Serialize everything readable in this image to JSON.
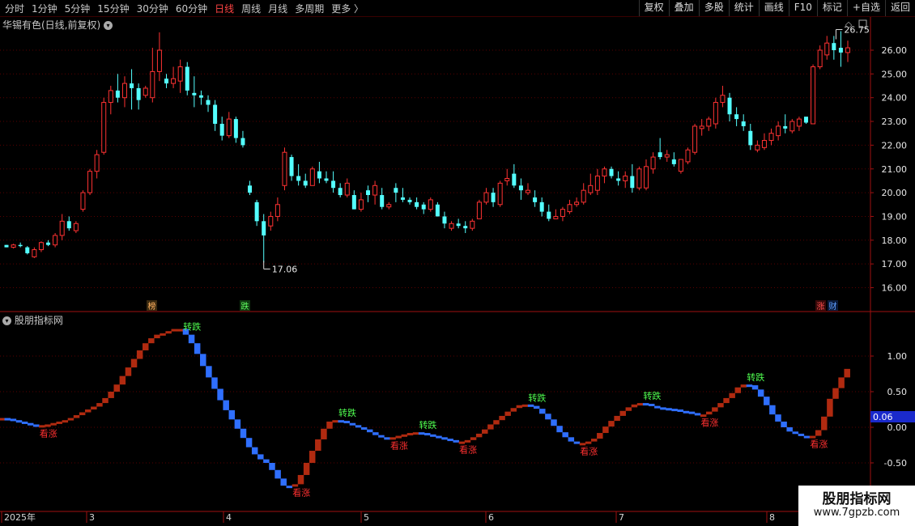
{
  "toolbar": {
    "periods": [
      "分时",
      "1分钟",
      "5分钟",
      "15分钟",
      "30分钟",
      "60分钟",
      "日线",
      "周线",
      "月线",
      "多周期",
      "更多 〉"
    ],
    "active_period": "日线",
    "actions": [
      "复权",
      "叠加",
      "多股",
      "统计",
      "画线",
      "F10",
      "标记",
      "+自选",
      "返回"
    ]
  },
  "price_panel": {
    "title": "华锡有色(日线,前复权)",
    "high_marker": "26.75",
    "low_marker": "17.06",
    "yticks": [
      "26.00",
      "25.00",
      "24.00",
      "23.00",
      "22.00",
      "21.00",
      "20.00",
      "19.00",
      "18.00",
      "17.00",
      "16.00"
    ],
    "badges": {
      "bang": "榜",
      "die": "跌",
      "zhang": "涨",
      "cai": "财"
    }
  },
  "indicator_panel": {
    "title": "股朋指标网",
    "yticks": [
      "1.00",
      "0.50",
      "0.00",
      "-0.50"
    ],
    "current_value": "0.06",
    "label_buy": "看涨",
    "label_turn": "转跌"
  },
  "xaxis": {
    "labels": [
      "2025年",
      "3",
      "4",
      "5",
      "6",
      "7",
      "8"
    ]
  },
  "watermark": {
    "title": "股朋指标网",
    "url": "www.7gpzb.com"
  },
  "colors": {
    "up": "#ff3232",
    "down": "#54ffff",
    "ind_up": "#b02a10",
    "ind_down": "#2f6fff",
    "grid": "#5a0000",
    "axis": "#a01010"
  },
  "chart_data": {
    "type": "candlestick",
    "title": "华锡有色(日线,前复权)",
    "ylim": [
      15.8,
      26.9
    ],
    "ohlc": [
      [
        17.8,
        17.8,
        17.7,
        17.7
      ],
      [
        17.7,
        17.85,
        17.65,
        17.8
      ],
      [
        17.8,
        17.9,
        17.7,
        17.75
      ],
      [
        17.7,
        17.75,
        17.4,
        17.45
      ],
      [
        17.3,
        17.7,
        17.25,
        17.6
      ],
      [
        17.6,
        17.95,
        17.5,
        17.9
      ],
      [
        17.9,
        18.0,
        17.75,
        17.8
      ],
      [
        17.8,
        18.3,
        17.7,
        18.2
      ],
      [
        18.2,
        19.1,
        18.0,
        18.8
      ],
      [
        18.8,
        19.0,
        18.4,
        18.5
      ],
      [
        18.4,
        18.8,
        18.3,
        18.7
      ],
      [
        19.3,
        20.1,
        19.2,
        20.0
      ],
      [
        20.0,
        21.0,
        19.9,
        20.9
      ],
      [
        20.9,
        21.8,
        20.6,
        21.6
      ],
      [
        21.7,
        24.0,
        21.6,
        23.8
      ],
      [
        23.8,
        24.5,
        23.3,
        24.3
      ],
      [
        24.3,
        25.0,
        23.8,
        24.0
      ],
      [
        24.0,
        24.9,
        23.6,
        24.6
      ],
      [
        24.6,
        25.2,
        23.5,
        24.4
      ],
      [
        24.4,
        24.6,
        23.5,
        23.9
      ],
      [
        24.1,
        24.5,
        24.0,
        24.4
      ],
      [
        24.0,
        26.1,
        23.8,
        25.1
      ],
      [
        25.1,
        26.75,
        24.7,
        26.0
      ],
      [
        24.8,
        25.0,
        24.4,
        24.6
      ],
      [
        24.6,
        25.3,
        24.4,
        24.8
      ],
      [
        24.7,
        25.6,
        24.2,
        25.3
      ],
      [
        25.3,
        25.5,
        24.1,
        24.3
      ],
      [
        24.2,
        24.9,
        23.6,
        24.1
      ],
      [
        24.1,
        24.3,
        23.7,
        24.0
      ],
      [
        23.9,
        24.1,
        23.4,
        23.7
      ],
      [
        23.7,
        23.9,
        22.6,
        22.9
      ],
      [
        22.9,
        23.2,
        22.2,
        22.4
      ],
      [
        22.4,
        23.4,
        22.3,
        23.1
      ],
      [
        23.1,
        23.2,
        22.1,
        22.3
      ],
      [
        22.3,
        22.6,
        21.9,
        22.0
      ],
      [
        20.3,
        20.5,
        19.9,
        20.0
      ],
      [
        19.6,
        19.7,
        18.6,
        18.8
      ],
      [
        18.8,
        19.1,
        17.06,
        18.2
      ],
      [
        18.6,
        19.2,
        18.4,
        19.0
      ],
      [
        19.0,
        19.8,
        18.8,
        19.5
      ],
      [
        20.3,
        21.9,
        20.1,
        21.7
      ],
      [
        21.5,
        21.6,
        20.5,
        20.7
      ],
      [
        20.7,
        21.2,
        20.3,
        20.5
      ],
      [
        20.5,
        20.8,
        20.2,
        20.3
      ],
      [
        20.3,
        21.1,
        20.3,
        21.0
      ],
      [
        20.9,
        21.3,
        20.4,
        20.6
      ],
      [
        20.6,
        20.9,
        20.4,
        20.5
      ],
      [
        20.5,
        20.9,
        20.0,
        20.2
      ],
      [
        20.2,
        20.4,
        19.8,
        19.9
      ],
      [
        19.9,
        20.6,
        19.8,
        20.4
      ],
      [
        19.9,
        20.1,
        19.3,
        19.3
      ],
      [
        19.3,
        20.0,
        19.2,
        19.7
      ],
      [
        20.1,
        20.3,
        19.6,
        19.9
      ],
      [
        19.9,
        20.5,
        19.5,
        20.3
      ],
      [
        19.9,
        20.2,
        19.3,
        19.4
      ],
      [
        19.4,
        19.6,
        19.3,
        19.5
      ],
      [
        20.2,
        20.4,
        19.6,
        20.0
      ],
      [
        19.8,
        20.2,
        19.6,
        19.7
      ],
      [
        19.7,
        19.8,
        19.5,
        19.6
      ],
      [
        19.6,
        19.8,
        19.3,
        19.4
      ],
      [
        19.5,
        19.6,
        19.1,
        19.3
      ],
      [
        19.3,
        19.8,
        19.2,
        19.7
      ],
      [
        19.5,
        19.6,
        19.0,
        19.0
      ],
      [
        19.0,
        19.2,
        18.5,
        18.7
      ],
      [
        18.5,
        18.8,
        18.4,
        18.7
      ],
      [
        18.7,
        18.9,
        18.5,
        18.6
      ],
      [
        18.6,
        18.8,
        18.3,
        18.5
      ],
      [
        18.5,
        18.9,
        18.4,
        18.8
      ],
      [
        18.9,
        19.7,
        18.9,
        19.6
      ],
      [
        19.6,
        20.2,
        19.5,
        20.0
      ],
      [
        20.0,
        20.2,
        19.4,
        19.6
      ],
      [
        19.5,
        20.5,
        19.4,
        20.4
      ],
      [
        20.5,
        21.0,
        20.3,
        20.6
      ],
      [
        20.8,
        21.2,
        20.2,
        20.3
      ],
      [
        20.3,
        20.6,
        19.7,
        20.1
      ],
      [
        20.0,
        20.4,
        19.9,
        20.1
      ],
      [
        19.8,
        20.1,
        19.4,
        19.6
      ],
      [
        19.6,
        19.8,
        19.0,
        19.2
      ],
      [
        19.2,
        19.5,
        18.8,
        18.9
      ],
      [
        18.9,
        19.3,
        18.9,
        19.0
      ],
      [
        19.0,
        19.4,
        18.8,
        19.3
      ],
      [
        19.2,
        19.7,
        19.1,
        19.5
      ],
      [
        19.5,
        19.8,
        19.4,
        19.6
      ],
      [
        19.6,
        20.4,
        19.5,
        20.1
      ],
      [
        20.0,
        20.8,
        19.9,
        20.3
      ],
      [
        20.1,
        21.0,
        19.9,
        20.7
      ],
      [
        20.7,
        21.1,
        20.4,
        21.0
      ],
      [
        21.0,
        21.1,
        20.6,
        20.7
      ],
      [
        20.6,
        20.9,
        20.3,
        20.5
      ],
      [
        20.5,
        20.9,
        20.2,
        20.7
      ],
      [
        20.7,
        21.2,
        20.0,
        20.2
      ],
      [
        20.2,
        21.1,
        20.1,
        21.0
      ],
      [
        20.2,
        21.4,
        20.1,
        21.1
      ],
      [
        21.0,
        21.7,
        20.8,
        21.5
      ],
      [
        21.7,
        22.3,
        21.4,
        21.5
      ],
      [
        21.5,
        21.8,
        21.3,
        21.6
      ],
      [
        21.4,
        21.7,
        21.1,
        21.2
      ],
      [
        20.9,
        21.4,
        20.8,
        21.4
      ],
      [
        21.3,
        21.9,
        21.2,
        21.8
      ],
      [
        21.7,
        22.9,
        21.6,
        22.8
      ],
      [
        22.7,
        23.1,
        22.4,
        22.8
      ],
      [
        22.8,
        23.2,
        22.6,
        23.1
      ],
      [
        22.9,
        24.0,
        22.7,
        23.8
      ],
      [
        23.8,
        24.5,
        23.6,
        24.1
      ],
      [
        24.0,
        24.2,
        23.0,
        23.3
      ],
      [
        23.3,
        23.6,
        22.8,
        23.1
      ],
      [
        23.0,
        23.3,
        22.6,
        22.8
      ],
      [
        22.6,
        22.9,
        21.8,
        22.0
      ],
      [
        21.8,
        22.2,
        21.7,
        22.0
      ],
      [
        21.9,
        22.5,
        21.8,
        22.2
      ],
      [
        22.2,
        22.7,
        22.0,
        22.5
      ],
      [
        22.4,
        23.0,
        22.2,
        22.8
      ],
      [
        22.8,
        23.3,
        22.5,
        22.7
      ],
      [
        22.6,
        23.1,
        22.5,
        23.0
      ],
      [
        22.8,
        23.2,
        22.6,
        23.1
      ],
      [
        23.2,
        23.1,
        22.9,
        22.95
      ],
      [
        22.9,
        25.4,
        22.9,
        25.3
      ],
      [
        25.3,
        26.2,
        25.2,
        26.0
      ],
      [
        25.8,
        26.6,
        25.6,
        26.3
      ],
      [
        26.3,
        26.6,
        25.6,
        26.0
      ],
      [
        26.1,
        26.8,
        25.3,
        25.9
      ],
      [
        25.9,
        26.4,
        25.5,
        26.1
      ]
    ],
    "indicator": {
      "ylim": [
        -0.85,
        1.45
      ],
      "values": [
        0.13,
        0.12,
        0.1,
        0.08,
        0.06,
        0.04,
        0.03,
        0.03,
        0.04,
        0.06,
        0.08,
        0.1,
        0.13,
        0.17,
        0.21,
        0.25,
        0.29,
        0.34,
        0.41,
        0.5,
        0.6,
        0.72,
        0.84,
        0.96,
        1.08,
        1.18,
        1.25,
        1.3,
        1.32,
        1.35,
        1.38,
        1.38,
        1.3,
        1.18,
        1.03,
        0.86,
        0.7,
        0.54,
        0.38,
        0.24,
        0.11,
        -0.02,
        -0.15,
        -0.28,
        -0.38,
        -0.45,
        -0.5,
        -0.6,
        -0.72,
        -0.82,
        -0.83,
        -0.8,
        -0.67,
        -0.5,
        -0.33,
        -0.17,
        -0.02,
        0.08,
        0.1,
        0.09,
        0.06,
        0.03,
        0.0,
        -0.03,
        -0.07,
        -0.11,
        -0.14,
        -0.15,
        -0.14,
        -0.12,
        -0.1,
        -0.08,
        -0.07,
        -0.08,
        -0.1,
        -0.12,
        -0.14,
        -0.16,
        -0.18,
        -0.2,
        -0.2,
        -0.18,
        -0.14,
        -0.09,
        -0.03,
        0.04,
        0.1,
        0.16,
        0.22,
        0.27,
        0.31,
        0.32,
        0.3,
        0.26,
        0.19,
        0.11,
        0.02,
        -0.07,
        -0.14,
        -0.2,
        -0.22,
        -0.22,
        -0.2,
        -0.16,
        -0.08,
        0.01,
        0.09,
        0.16,
        0.23,
        0.28,
        0.32,
        0.34,
        0.33,
        0.3,
        0.28,
        0.27,
        0.26,
        0.25,
        0.23,
        0.22,
        0.2,
        0.18,
        0.18,
        0.22,
        0.28,
        0.34,
        0.41,
        0.48,
        0.56,
        0.6,
        0.59,
        0.53,
        0.43,
        0.31,
        0.18,
        0.08,
        0.0,
        -0.06,
        -0.09,
        -0.12,
        -0.14,
        -0.12,
        -0.04,
        0.15,
        0.4,
        0.55,
        0.7,
        0.82
      ]
    }
  }
}
